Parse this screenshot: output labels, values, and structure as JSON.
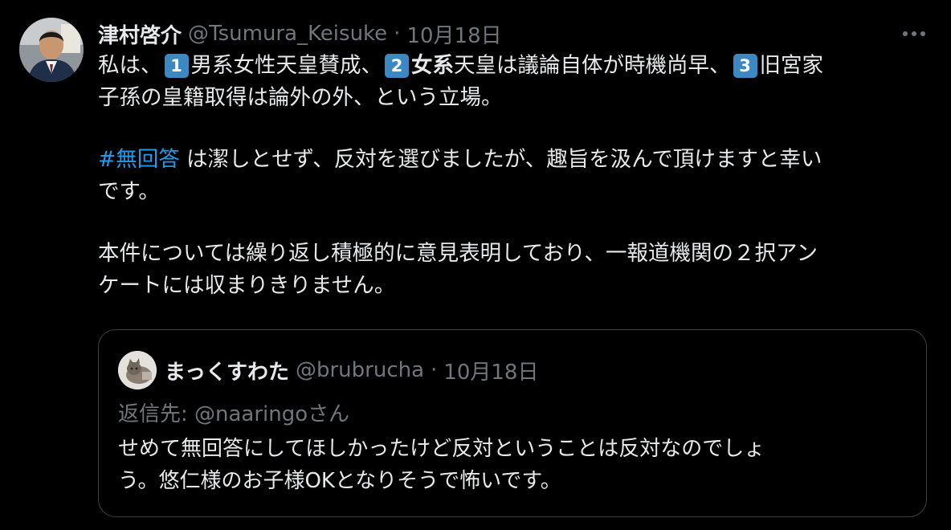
{
  "tweet": {
    "author_name": "津村啓介",
    "author_handle": "@Tsumura_Keisuke",
    "separator": "·",
    "date": "10月18日",
    "more_icon": "more-horizontal-icon",
    "line1": {
      "a": "私は、",
      "k1": "1",
      "b": "男系女性天皇賛成、",
      "k2": "2",
      "c_bold": "女系",
      "d": "天皇は議論自体が時機尚早、",
      "k3": "3",
      "e": "旧宮家"
    },
    "line2": "子孫の皇籍取得は論外の外、という立場。",
    "hashtag": "#無回答",
    "line3_rest": " は潔しとせず、反対を選びましたが、趣旨を汲んで頂けますと幸い",
    "line4": "です。",
    "line5": "本件については繰り返し積極的に意見表明しており、一報道機関の２択アン",
    "line6": "ケートには収まりきりません。"
  },
  "quote": {
    "author_name": "まっくすわた",
    "author_handle": "@brubrucha",
    "separator": "·",
    "date": "10月18日",
    "reply_to": "返信先: @naaringoさん",
    "line1": "せめて無回答にしてほしかったけど反対ということは反対なのでしょ",
    "line2": "う。悠仁様のお子様OKとなりそうで怖いです。"
  },
  "colors": {
    "background": "#000000",
    "text": "#e7e9ea",
    "muted": "#71767b",
    "link": "#1d9bf0",
    "keycap": "#3b88c3",
    "quote_border": "#3e4144"
  }
}
